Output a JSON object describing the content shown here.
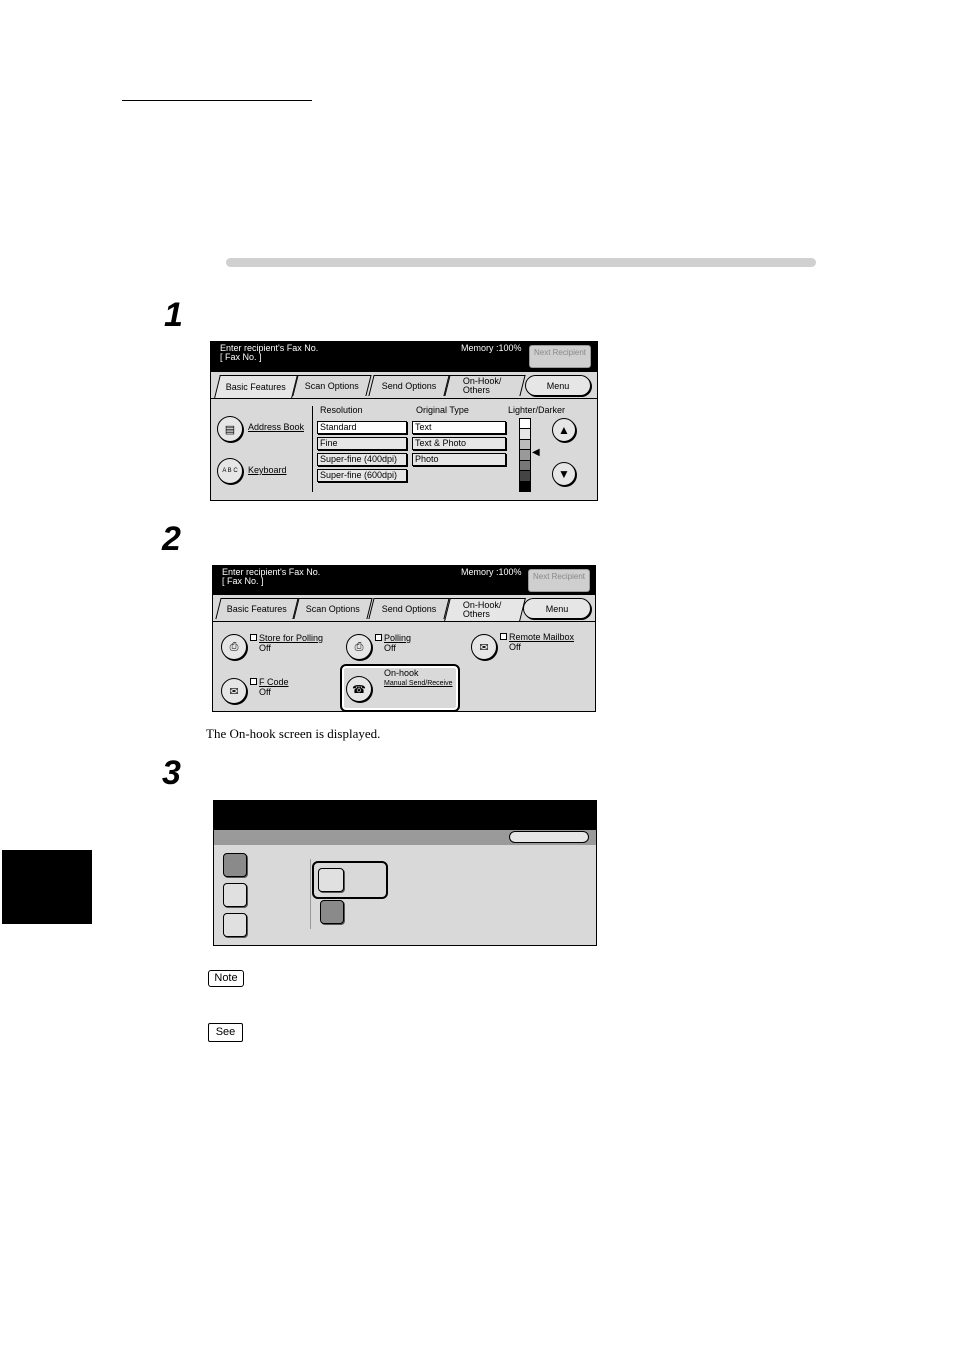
{
  "steps": [
    "1",
    "2",
    "3"
  ],
  "screen1": {
    "header_line1": "Enter recipient's Fax No.",
    "header_line2": "[  Fax No. ]",
    "memory": "Memory :100%",
    "next_recipient": "Next Recipient",
    "tabs": [
      "Basic Features",
      "Scan Options",
      "Send Options",
      "On-Hook/ Others"
    ],
    "menu": "Menu",
    "address_book": "Address Book",
    "keyboard": "Keyboard",
    "keyboard_icon": "A B C",
    "resolution_label": "Resolution",
    "resolution_options": [
      "Standard",
      "Fine",
      "Super-fine (400dpi)",
      "Super-fine (600dpi)"
    ],
    "original_type_label": "Original Type",
    "original_type_options": [
      "Text",
      "Text & Photo",
      "Photo"
    ],
    "lighter_darker_label": "Lighter/Darker",
    "lighter_darker_level": 4
  },
  "screen2": {
    "header_line1": "Enter recipient's Fax No.",
    "header_line2": "[  Fax No. ]",
    "memory": "Memory :100%",
    "next_recipient": "Next Recipient",
    "tabs": [
      "Basic Features",
      "Scan Options",
      "Send Options",
      "On-Hook/ Others"
    ],
    "menu": "Menu",
    "store_for_polling": "Store for Polling",
    "store_for_polling_value": "Off",
    "polling": "Polling",
    "polling_value": "Off",
    "remote_mailbox": "Remote Mailbox",
    "remote_mailbox_value": "Off",
    "f_code": "F Code",
    "f_code_value": "Off",
    "on_hook": "On-hook",
    "on_hook_sub": "Manual Send/Receive"
  },
  "caption_step2": "The On-hook screen is displayed.",
  "note_label": "Note",
  "see_label": "See"
}
